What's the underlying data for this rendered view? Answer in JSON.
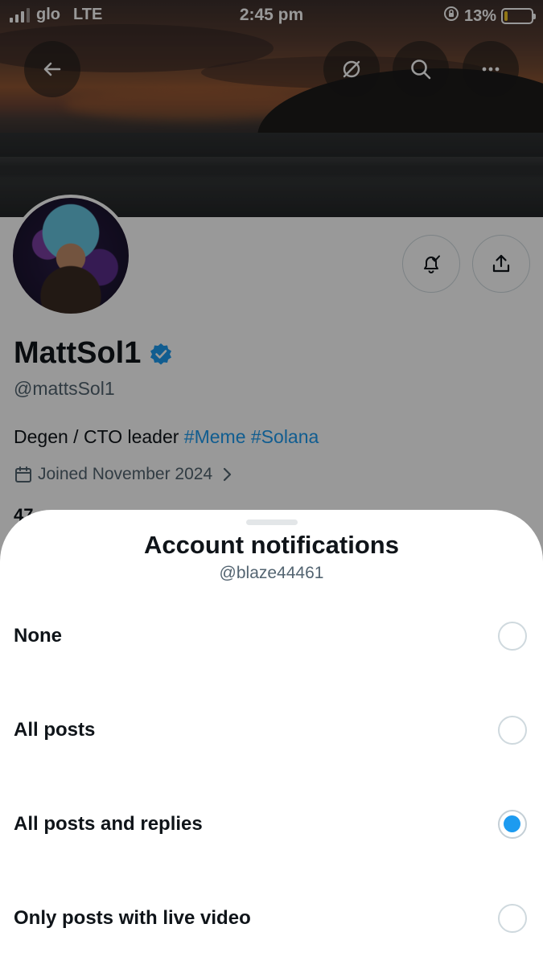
{
  "status_bar": {
    "carrier": "glo",
    "network": "LTE",
    "time": "2:45 pm",
    "battery_percent": "13%",
    "battery_level": 0.13,
    "battery_color": "#f3c623"
  },
  "top_bar": {
    "back_icon": "arrow-left-icon",
    "grok_icon": "grok-icon",
    "search_icon": "search-icon",
    "more_icon": "more-horizontal-icon"
  },
  "profile": {
    "display_name": "MattSol1",
    "verified": true,
    "handle": "@mattsSol1",
    "bio_text": "Degen / CTO leader ",
    "bio_tags": [
      "#Meme",
      "#Solana"
    ],
    "joined": "Joined November 2024",
    "stats_peek": "47",
    "actions": {
      "notify_icon": "bell-check-icon",
      "share_icon": "share-icon"
    }
  },
  "sheet": {
    "title": "Account notifications",
    "subtitle": "@blaze44461",
    "options": [
      {
        "label": "None",
        "selected": false
      },
      {
        "label": "All posts",
        "selected": false
      },
      {
        "label": "All posts and replies",
        "selected": true
      },
      {
        "label": "Only posts with live video",
        "selected": false
      }
    ]
  },
  "colors": {
    "accent": "#1d9bf0",
    "text_primary": "#0f1419",
    "text_secondary": "#536471",
    "radio_border": "#cfd9de"
  }
}
